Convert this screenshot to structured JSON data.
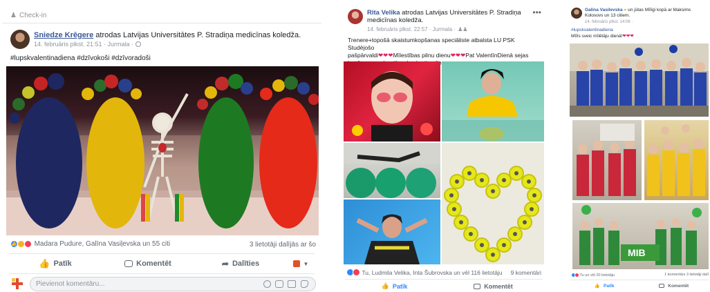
{
  "post1": {
    "checkin": "Check-in",
    "author": "Sniedze Krēgere",
    "action": "atrodas Latvijas Universitātes P. Stradiņa medicīnas koledža.",
    "meta": "14. februāris plkst. 21:51 · Jurmala ·",
    "hashtags": "#lupskvalentinadiena #dzīvokoši #dzīvoradoši",
    "reactions_text": "Madara Pudure, Galīna Vasiļevska un 55 citi",
    "shares": "3 lietotāji dalījās ar šo",
    "like_label": "Patīk",
    "comment_label": "Komentēt",
    "share_label": "Dalīties",
    "comment_placeholder": "Pievienot komentāru..."
  },
  "post2": {
    "author": "Rita Velika",
    "action": "atrodas Latvijas Universitātes P. Stradiņa medicīnas koledža.",
    "meta": "14. februāris plkst. 22:57 · Jurmala ·",
    "text_line1": "Trenere+topošā skaistumkopšanas speciāliste atbalsta LU PSK Studējošo",
    "text_line2a": "pašpārvaldi",
    "text_line2b": "Mīlestības pilnu dienu",
    "text_line2c": "Pat ValentīnDienā sejas",
    "text_line3": "kopšana-maskas#lupskvalentinadiena",
    "reactions_text": "Tu, Ludmila Velika, Inta Šubrovska un vēl 116 lietotāju",
    "comments": "9 komentāri",
    "like_label": "Patīk",
    "comment_label": "Komentēt"
  },
  "post3": {
    "author": "Galina Vasilevska",
    "action": "un jūtas Mīlīgi kopā ar Maksims Kolosovs un 13 citiem.",
    "meta": "14. februāris plkst. 14:06 ·",
    "hashtag": "#lupskvalentinadiena",
    "text": "Mīlīs sveic mīlētāju dienā!",
    "reactions_text": "Tu un vēl 20 lietotāju",
    "stats": "1 komentārs 3 lietotāji dalī",
    "like_label": "Patīk",
    "comment_label": "Komentēt",
    "banner_text": "MIB"
  },
  "colors": {
    "link": "#385898",
    "like_blue": "#2d88ff",
    "love_red": "#f33e58"
  }
}
